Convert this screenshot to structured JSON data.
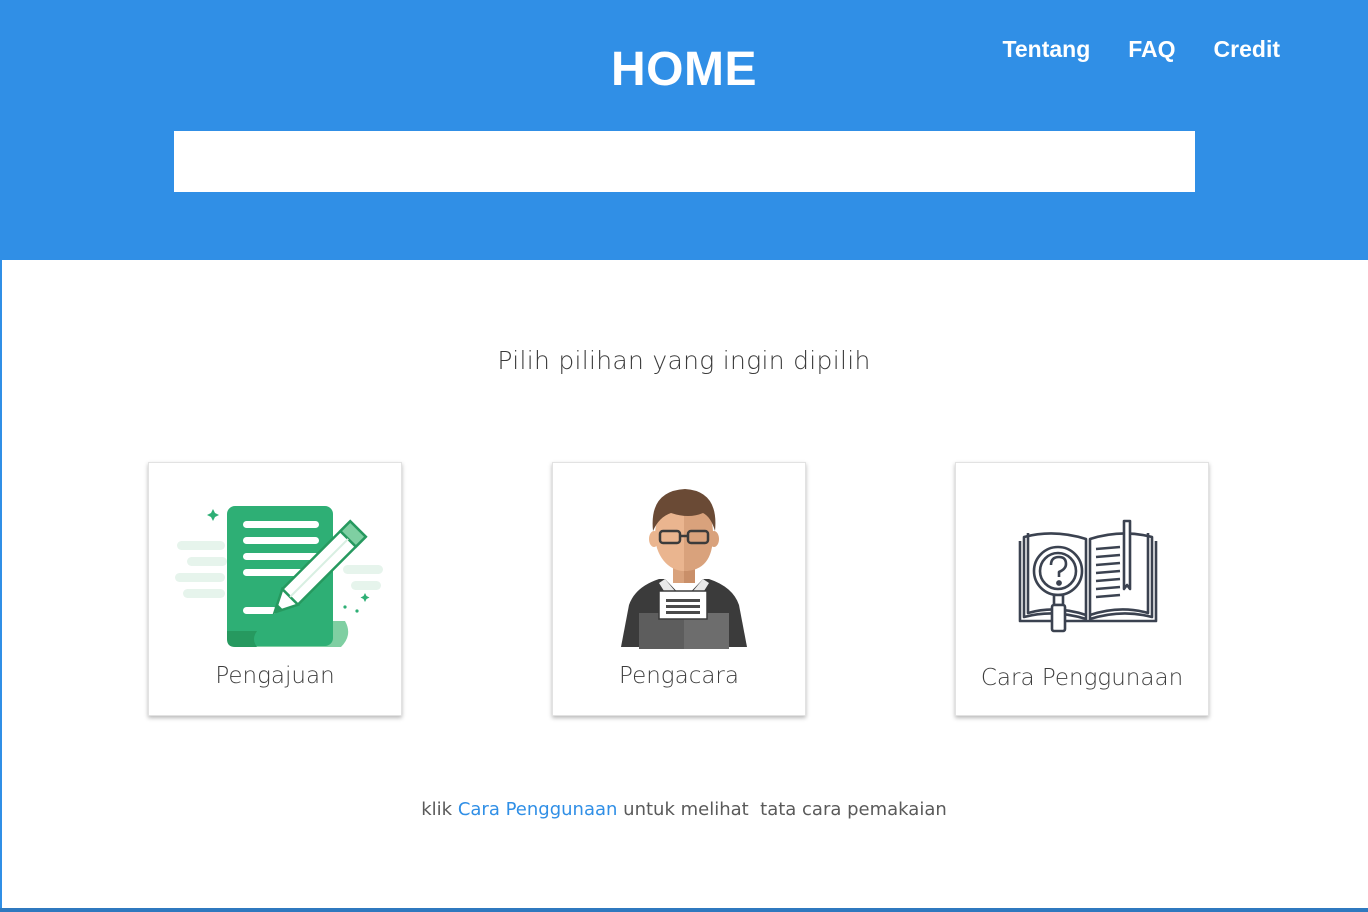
{
  "header": {
    "title": "HOME",
    "nav": {
      "about": "Tentang",
      "faq": "FAQ",
      "credit": "Credit"
    },
    "search": {
      "value": "",
      "placeholder": ""
    },
    "color": "#308fe6"
  },
  "main": {
    "subtitle": "Pilih pilihan yang ingin dipilih",
    "cards": [
      {
        "label": "Pengajuan",
        "icon": "document-pencil-icon"
      },
      {
        "label": "Pengacara",
        "icon": "lawyer-icon"
      },
      {
        "label": "Cara Penggunaan",
        "icon": "book-question-icon"
      }
    ],
    "hint": {
      "prefix": "klik",
      "link": "Cara Penggunaan",
      "suffix": "untuk melihat  tata cara pemakaian"
    }
  }
}
